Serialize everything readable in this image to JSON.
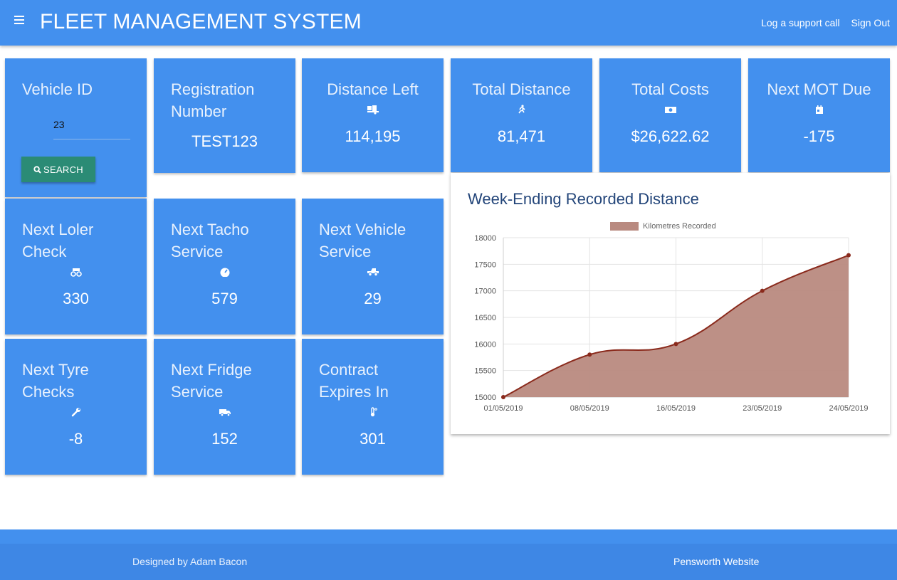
{
  "header": {
    "title": "FLEET MANAGEMENT SYSTEM",
    "links": [
      "Log a support call",
      "Sign Out"
    ]
  },
  "search": {
    "label": "Vehicle ID",
    "value": "23",
    "button": "SEARCH"
  },
  "cards": {
    "registration": {
      "label": "Registration Number",
      "value": "TEST123"
    },
    "distance_left": {
      "label": "Distance Left",
      "value": "114,195",
      "icon": "truck-loading-icon"
    },
    "total_distance": {
      "label": "Total Distance",
      "value": "81,471",
      "icon": "running-icon"
    },
    "total_costs": {
      "label": "Total Costs",
      "value": "$26,622.62",
      "icon": "money-bill-icon"
    },
    "next_mot": {
      "label": "Next MOT Due",
      "value": "-175",
      "icon": "calendar-icon"
    },
    "loler": {
      "label": "Next Loler Check",
      "value": "330",
      "icon": "truck-monster-icon"
    },
    "tacho": {
      "label": "Next Tacho Service",
      "value": "579",
      "icon": "tachometer-icon"
    },
    "vehicle_service": {
      "label": "Next Vehicle Service",
      "value": "29",
      "icon": "truck-pickup-icon"
    },
    "tyre": {
      "label": "Next Tyre Checks",
      "value": "-8",
      "icon": "wrench-icon"
    },
    "fridge": {
      "label": "Next Fridge Service",
      "value": "152",
      "icon": "shipping-truck-icon"
    },
    "contract": {
      "label": "Contract Expires In",
      "value": "301",
      "icon": "thermometer-icon"
    }
  },
  "chart_data": {
    "type": "area",
    "title": "Week-Ending Recorded Distance",
    "categories": [
      "01/05/2019",
      "08/05/2019",
      "16/05/2019",
      "23/05/2019",
      "24/05/2019"
    ],
    "series": [
      {
        "name": "Kilometres Recorded",
        "values": [
          15000,
          15800,
          16000,
          17000,
          17670
        ]
      }
    ],
    "ylim": [
      15000,
      18000
    ],
    "yticks": [
      15000,
      15500,
      16000,
      16500,
      17000,
      17500,
      18000
    ],
    "grid": true,
    "legend": "top",
    "colors": {
      "fill": "#b98a80",
      "line": "#8a2a1c"
    }
  },
  "footer": {
    "credit": "Designed by Adam Bacon",
    "link": "Pensworth Website"
  }
}
